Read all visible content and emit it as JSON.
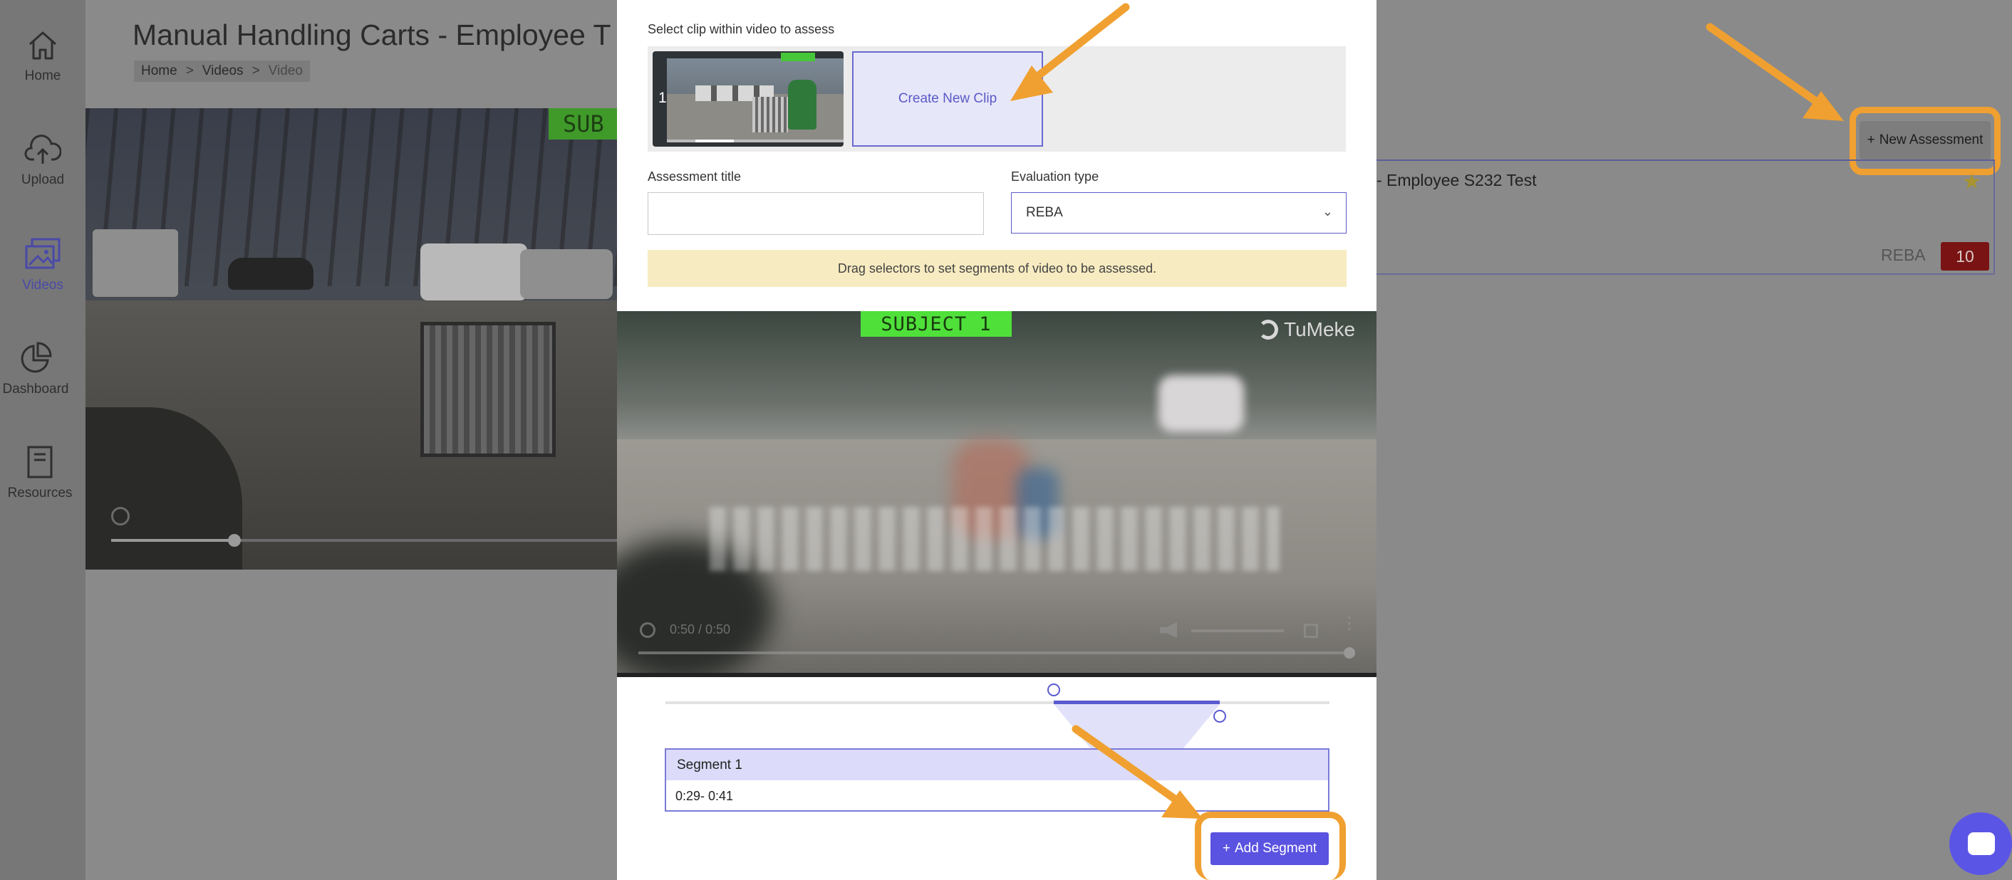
{
  "sidebar": {
    "items": [
      {
        "label": "Home",
        "icon": "home-icon"
      },
      {
        "label": "Upload",
        "icon": "cloud-upload-icon"
      },
      {
        "label": "Videos",
        "icon": "video-gallery-icon",
        "active": true
      },
      {
        "label": "Dashboard",
        "icon": "pie-chart-icon"
      },
      {
        "label": "Resources",
        "icon": "book-icon"
      }
    ]
  },
  "page": {
    "title": "Manual Handling Carts - Employee T",
    "breadcrumb": [
      "Home",
      "Videos",
      "Video"
    ],
    "breadcrumb_sep": ">",
    "video_overlay_tag": "SUB"
  },
  "assessments": {
    "new_button_label": "New Assessment",
    "new_button_icon": "+",
    "item": {
      "name": "- Employee S232 Test",
      "type": "REBA",
      "score": "10",
      "score_color": "#7a1414",
      "starred": true
    }
  },
  "modal": {
    "clip_label": "Select clip within video to assess",
    "clips": [
      {
        "number": "1"
      }
    ],
    "create_clip_label": "Create New Clip",
    "assessment_title_label": "Assessment title",
    "assessment_title_value": "",
    "evaluation_type_label": "Evaluation type",
    "evaluation_type_value": "REBA",
    "hint": "Drag selectors to set segments of video to be assessed.",
    "player": {
      "subject_tag": "SUBJECT  1",
      "watermark": "TuMeke",
      "time": "0:50 / 0:50"
    },
    "segment": {
      "range_start_fraction": 0.585,
      "range_end_fraction": 0.835,
      "title": "Segment 1",
      "range_text": "0:29- 0:41"
    },
    "add_segment_label": "Add Segment",
    "add_segment_icon": "+"
  },
  "colors": {
    "accent": "#5a52e0",
    "annotation": "#f0a030",
    "hint_bg": "#f7ebc1"
  }
}
